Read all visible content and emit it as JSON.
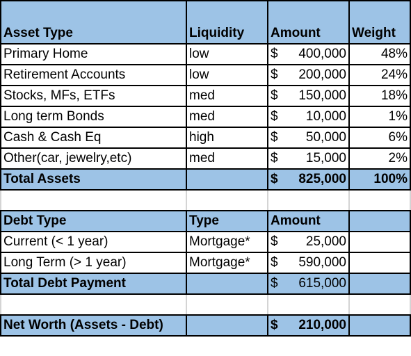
{
  "assets": {
    "headers": [
      "Asset Type",
      "Liquidity",
      "Amount",
      "Weight"
    ],
    "rows": [
      {
        "type": "Primary Home",
        "liquidity": "low",
        "currency": "$",
        "amount": "400,000",
        "weight": "48%"
      },
      {
        "type": "Retirement Accounts",
        "liquidity": "low",
        "currency": "$",
        "amount": "200,000",
        "weight": "24%"
      },
      {
        "type": "Stocks, MFs, ETFs",
        "liquidity": "med",
        "currency": "$",
        "amount": "150,000",
        "weight": "18%"
      },
      {
        "type": "Long term Bonds",
        "liquidity": "med",
        "currency": "$",
        "amount": "10,000",
        "weight": "1%"
      },
      {
        "type": "Cash & Cash Eq",
        "liquidity": "high",
        "currency": "$",
        "amount": "50,000",
        "weight": "6%"
      },
      {
        "type": "Other(car, jewelry,etc)",
        "liquidity": "med",
        "currency": "$",
        "amount": "15,000",
        "weight": "2%"
      }
    ],
    "total": {
      "label": "Total Assets",
      "currency": "$",
      "amount": "825,000",
      "weight": "100%"
    }
  },
  "debts": {
    "headers": [
      "Debt Type",
      "Type",
      "Amount",
      ""
    ],
    "rows": [
      {
        "type": "Current (< 1 year)",
        "kind": "Mortgage*",
        "currency": "$",
        "amount": "25,000"
      },
      {
        "type": "Long Term (> 1 year)",
        "kind": "Mortgage*",
        "currency": "$",
        "amount": "590,000"
      }
    ],
    "total": {
      "label": "Total Debt Payment",
      "currency": "$",
      "amount": "615,000"
    }
  },
  "net_worth": {
    "label": "Net Worth (Assets - Debt)",
    "currency": "$",
    "amount": "210,000"
  },
  "colors": {
    "header_fill": "#9DC3E6",
    "border": "#000000"
  }
}
